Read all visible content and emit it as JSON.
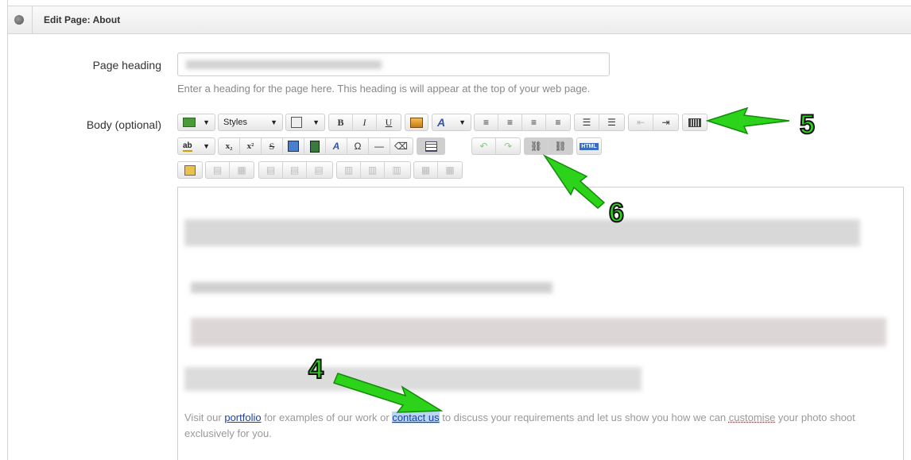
{
  "header": {
    "title": "Edit Page: About",
    "icon": "globe-icon"
  },
  "form": {
    "heading_label": "Page heading",
    "heading_hint": "Enter a heading for the page here. This heading is will appear at the top of your web page.",
    "body_label": "Body (optional)"
  },
  "toolbar": {
    "styles_label": "Styles",
    "bold": "B",
    "italic": "I",
    "underline": "U",
    "subscript": "x₂",
    "superscript": "x²",
    "strike": "S",
    "omega": "Ω",
    "hr": "—",
    "html": "HTML"
  },
  "editor": {
    "text_before": "Visit our ",
    "link1": "portfolio",
    "text_mid": " for examples of our work or ",
    "link2": "contact us",
    "text_after1": " to discuss your requirements and let us show you how we can ",
    "misspelled": "customise",
    "text_after2": " your photo shoot exclusively for you."
  },
  "annotations": {
    "a4": "4",
    "a5": "5",
    "a6": "6"
  },
  "colors": {
    "arrow": "#2cd31a",
    "link": "#1a3fb0",
    "selection": "#b9d7f5"
  }
}
